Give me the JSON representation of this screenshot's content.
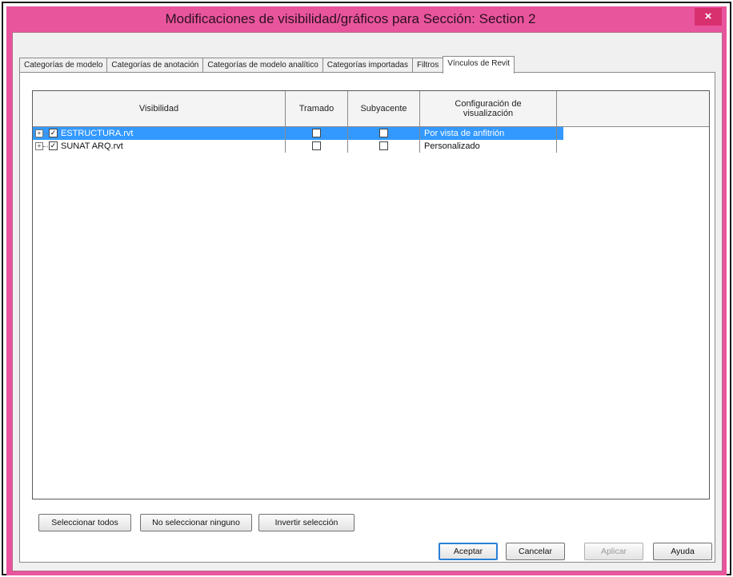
{
  "window": {
    "title": "Modificaciones de visibilidad/gráficos para Sección: Section 2",
    "close_label": "×"
  },
  "tabs": [
    {
      "label": "Categorías de modelo",
      "active": false
    },
    {
      "label": "Categorías de anotación",
      "active": false
    },
    {
      "label": "Categorías de modelo analítico",
      "active": false
    },
    {
      "label": "Categorías importadas",
      "active": false
    },
    {
      "label": "Filtros",
      "active": false
    },
    {
      "label": "Vínculos de Revit",
      "active": true
    }
  ],
  "grid": {
    "columns": {
      "visibility": "Visibilidad",
      "halftone": "Tramado",
      "underlay": "Subyacente",
      "display_settings": "Configuración de visualización"
    },
    "rows": [
      {
        "name": "ESTRUCTURA.rvt",
        "visible": true,
        "halftone": false,
        "underlay": false,
        "display": "Por vista de anfitrión",
        "selected": true
      },
      {
        "name": "SUNAT ARQ.rvt",
        "visible": true,
        "halftone": false,
        "underlay": false,
        "display": "Personalizado",
        "selected": false
      }
    ]
  },
  "selection_buttons": {
    "select_all": "Seleccionar todos",
    "select_none": "No seleccionar ninguno",
    "invert": "Invertir selección"
  },
  "dialog_buttons": {
    "ok": "Aceptar",
    "cancel": "Cancelar",
    "apply": "Aplicar",
    "help": "Ayuda"
  },
  "colors": {
    "title_bar": "#e9559d",
    "selection": "#3399ff"
  }
}
